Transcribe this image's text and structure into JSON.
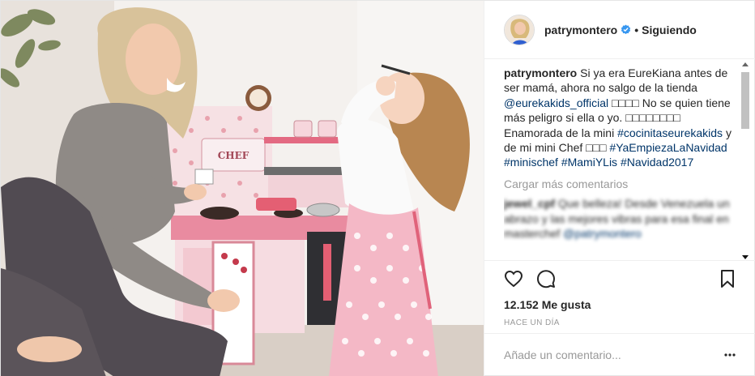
{
  "post": {
    "username": "patrymontero",
    "follow_status": "Siguiendo",
    "separator": "•",
    "caption": {
      "username": "patrymontero",
      "text_1": "Si ya era EureKiana antes de ser mamá, ahora no salgo de la tienda",
      "mention": "@eurekakids_official",
      "text_2": "□□□□ No se quien tiene más peligro si ella o yo. □□□□□□□□ Enamorada de la mini",
      "hashtag_1": "#cocinitaseurekakids",
      "text_3": "y de mi mini Chef □□□",
      "hashtag_2": "#YaEmpiezaLaNavidad",
      "hashtag_3": "#minischef",
      "hashtag_4": "#MamiYLis",
      "hashtag_5": "#Navidad2017"
    },
    "load_more": "Cargar más comentarios",
    "comment_1": {
      "username": "jewel_cpf",
      "text": "Que belleza! Desde Venezuela un abrazo y las mejores vibras para esa final en masterchef",
      "mention": "@patrymontero"
    },
    "likes": "12.152 Me gusta",
    "timestamp": "Hace un día",
    "comment_placeholder": "Añade un comentario...",
    "toy_label": "CHEF"
  },
  "icons": {
    "verified": "verified-badge-icon",
    "like": "heart-icon",
    "comment": "comment-icon",
    "save": "bookmark-icon",
    "more": "more-options-icon"
  },
  "colors": {
    "link": "#003569",
    "verified": "#3897f0",
    "muted": "#999999",
    "text": "#262626"
  }
}
